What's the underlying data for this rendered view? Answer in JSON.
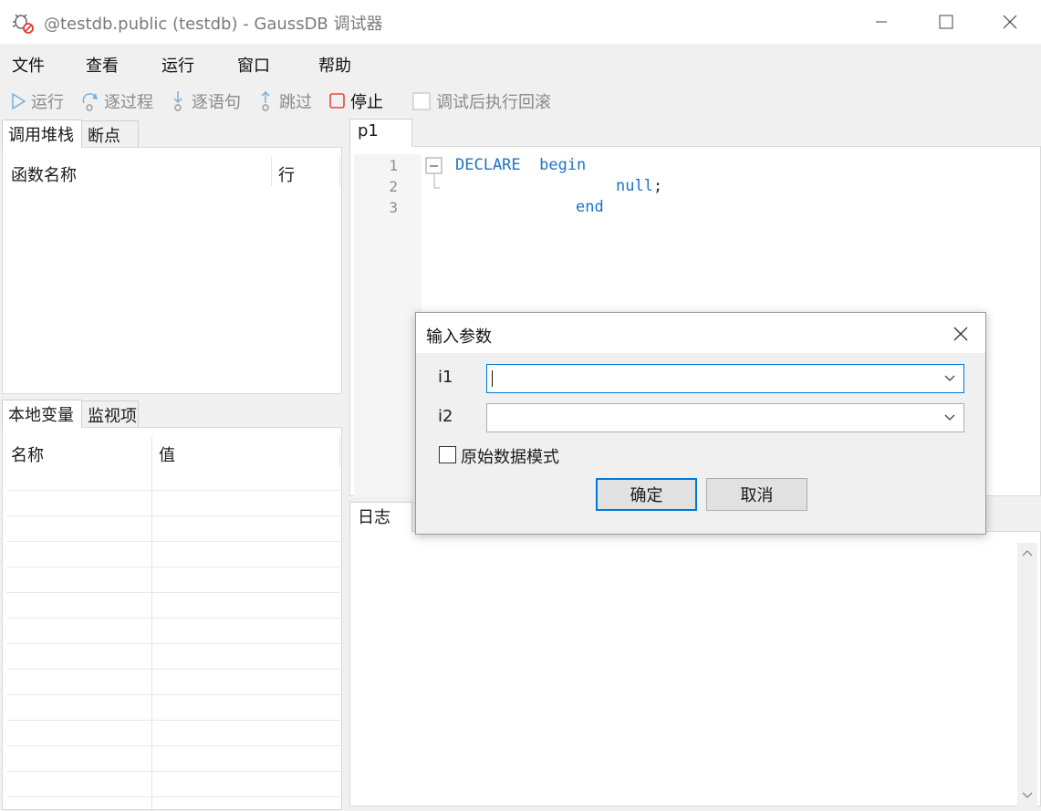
{
  "window": {
    "title": "@testdb.public (testdb) - GaussDB 调试器"
  },
  "menu": {
    "items": [
      "文件",
      "查看",
      "运行",
      "窗口",
      "帮助"
    ]
  },
  "toolbar": {
    "run": "运行",
    "step_over": "逐过程",
    "step_into": "逐语句",
    "step_out": "跳过",
    "stop": "停止",
    "rollback_after_debug": "调试后执行回滚"
  },
  "left_top": {
    "tabs": [
      "调用堆栈",
      "断点"
    ],
    "columns": [
      "函数名称",
      "行"
    ]
  },
  "left_bottom": {
    "tabs": [
      "本地变量",
      "监视项"
    ],
    "columns": [
      "名称",
      "值"
    ]
  },
  "editor": {
    "tab": "p1",
    "lines": [
      {
        "num": "1",
        "text": "DECLARE  begin"
      },
      {
        "num": "2",
        "text": "null"
      },
      {
        "num": "3",
        "text": "end"
      }
    ],
    "semicolon": ";"
  },
  "log": {
    "tab": "日志"
  },
  "dialog": {
    "title": "输入参数",
    "params": [
      {
        "label": "i1",
        "value": ""
      },
      {
        "label": "i2",
        "value": ""
      }
    ],
    "raw_mode_label": "原始数据模式",
    "raw_mode_checked": false,
    "ok": "确定",
    "cancel": "取消"
  },
  "colors": {
    "accent": "#0078d7",
    "keyword": "#1e73c8",
    "stop_icon": "#e04a3a",
    "toolbar_icon": "#6fb3e8"
  },
  "icons": [
    "bug-debug-icon",
    "minimize-icon",
    "maximize-icon",
    "close-icon",
    "play-icon",
    "step-over-icon",
    "step-into-icon",
    "step-out-icon",
    "stop-icon",
    "checkbox-icon",
    "chevron-down-icon",
    "scroll-up-icon",
    "scroll-down-icon",
    "fold-minus-icon"
  ]
}
